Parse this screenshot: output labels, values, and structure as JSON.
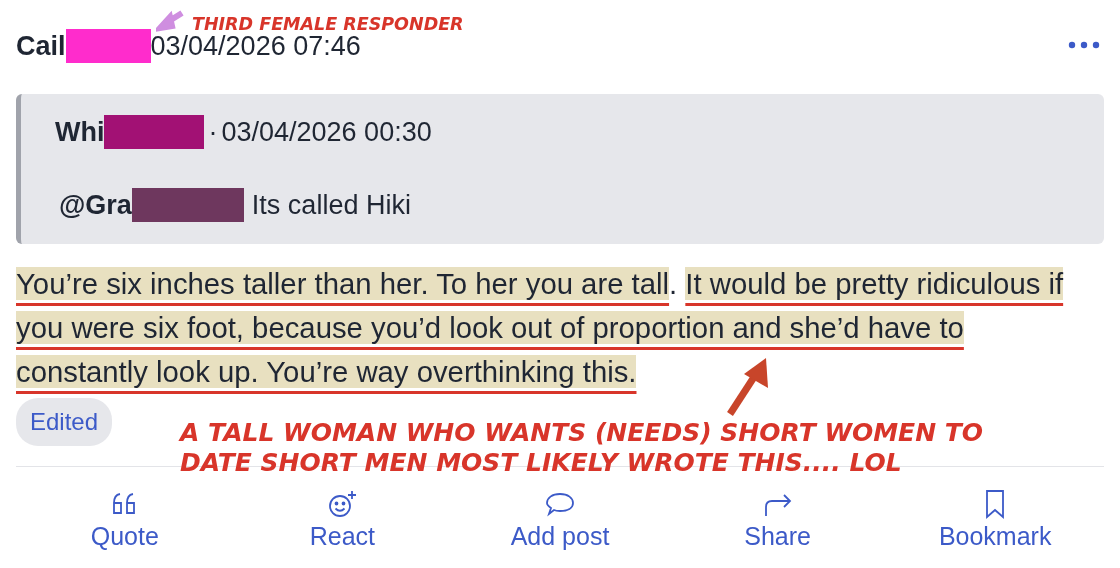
{
  "post": {
    "author": "Cail",
    "author_redaction": {
      "color": "#ff2ccc"
    },
    "timestamp": "03/04/2026 07:46",
    "quote": {
      "author": "Whi",
      "author_redaction": {
        "color": "#a21174"
      },
      "separator": "·",
      "timestamp": "03/04/2026 00:30",
      "mention": "@Gra",
      "mention_redaction": {
        "color": "#6e375e"
      },
      "text": "Its called Hiki"
    },
    "body": [
      {
        "text": "You’re six inches taller than her. To her you are tall",
        "highlighted": true
      },
      {
        "text": ". ",
        "highlighted": false
      },
      {
        "text": "It would be pretty ridiculous if you were six foot, because you’d look out of proportion and she’d have to constantly look up. You’re way overthinking this.",
        "highlighted": true
      }
    ],
    "edited_badge": "Edited",
    "actions": [
      {
        "kind": "quote",
        "label": "Quote"
      },
      {
        "kind": "react",
        "label": "React"
      },
      {
        "kind": "reply",
        "label": "Add post"
      },
      {
        "kind": "share",
        "label": "Share"
      },
      {
        "kind": "bookmark",
        "label": "Bookmark"
      }
    ]
  },
  "annotations": [
    {
      "kind": "label",
      "text": "THIRD FEMALE RESPONDER"
    },
    {
      "kind": "comment",
      "text": "A TALL WOMAN WHO WANTS (NEEDS) SHORT WOMEN TO DATE SHORT MEN MOST LIKELY WROTE THIS.... LOL"
    }
  ]
}
